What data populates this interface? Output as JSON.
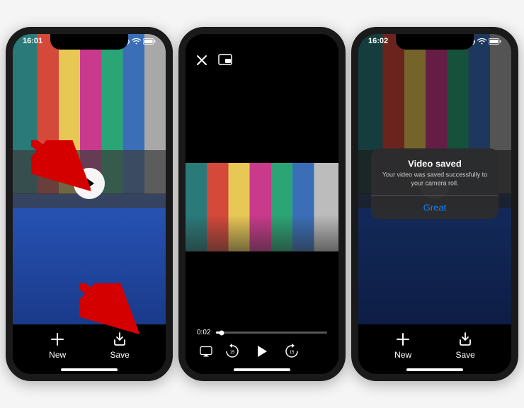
{
  "status": {
    "time": "16:01",
    "time_alt": "16:02"
  },
  "phone1": {
    "buttons": {
      "new": "New",
      "save": "Save"
    }
  },
  "phone2": {
    "scrubber_time": "0:02"
  },
  "phone3": {
    "dialog": {
      "title": "Video saved",
      "message": "Your video was saved successfully to your camera roll.",
      "button": "Great"
    },
    "buttons": {
      "new": "New",
      "save": "Save"
    }
  }
}
